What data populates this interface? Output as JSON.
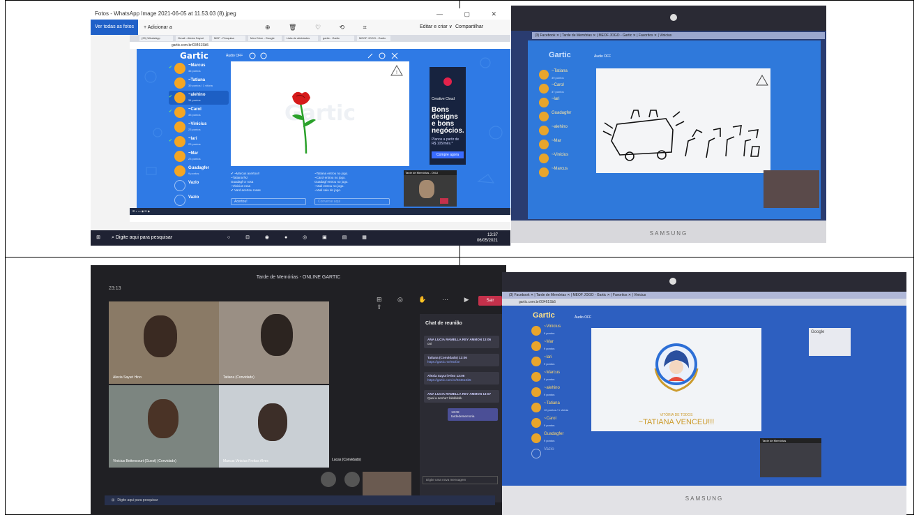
{
  "panel1": {
    "window_title": "Fotos - WhatsApp Image 2021-06-05 at 11.53.03 (8).jpeg",
    "window_controls": "— ▢ ✕",
    "all_photos": "Ver todas as fotos",
    "add_to": "+ Adicionar a",
    "viewer_tools": "⊕ 🗑 ♡ ⟲ ⌗",
    "edit_create": "Editar e criar ∨",
    "share": "Compartilhar",
    "browser_tabs": [
      "(29) WhatsApp",
      "Gmail - Alexia Sayuri",
      "MDF - Pesquisa",
      "Meu Drive - Google",
      "Lista de atividades",
      "gartic - Gartic",
      "MEOF JOGO - Gartic"
    ],
    "url": "gartic.com.br/03461Sb5",
    "gartic": {
      "logo": "Gartic",
      "audio": "Áudio OFF",
      "players": [
        {
          "name": "~Marcus",
          "score": "46 pontos",
          "checked": true,
          "highlight": false,
          "empty": false
        },
        {
          "name": "~Tatiana",
          "score": "39 pontos / 1 vitória",
          "checked": false,
          "highlight": false,
          "empty": false
        },
        {
          "name": "~alehino",
          "score": "34 pontos",
          "checked": true,
          "highlight": true,
          "empty": false
        },
        {
          "name": "~Carol",
          "score": "33 pontos",
          "checked": true,
          "highlight": false,
          "empty": false
        },
        {
          "name": "~Vinicius",
          "score": "23 pontos",
          "checked": false,
          "highlight": false,
          "empty": false
        },
        {
          "name": "~lari",
          "score": "23 pontos",
          "checked": true,
          "highlight": false,
          "empty": false
        },
        {
          "name": "~Mar",
          "score": "23 pontos",
          "checked": false,
          "highlight": false,
          "empty": false
        },
        {
          "name": "Guadagfer",
          "score": "9 pontos",
          "checked": false,
          "highlight": false,
          "empty": false
        },
        {
          "name": "Vazio",
          "score": "",
          "checked": false,
          "highlight": false,
          "empty": true
        },
        {
          "name": "Vazio",
          "score": "",
          "checked": false,
          "highlight": false,
          "empty": true
        }
      ],
      "chat_lines": [
        "✔ ~Marcus acertou!!",
        "~Tatiana fez",
        "Guadagf cr rosa",
        "~Vinicius rosa",
        "✔ Vard acertou rosas"
      ],
      "answer_lines": [
        "~Tatiana entrou no jogo.",
        "~Carol entrou no jogo.",
        "Guadagf entrou no jogo.",
        "~Vadi entrou no jogo.",
        "~Vadi saiu do jogo."
      ],
      "chat_input": "Acertou!",
      "answer_input": "Converse aqui",
      "ad": {
        "brand": "Creative Cloud",
        "headline": "Bons designs e bons negócios.",
        "sub": "Planos a partir de R$ 105/mês.*",
        "cta": "Compre agora"
      },
      "cam_title": "Tarde de Memórias - ONLI"
    },
    "taskbar": {
      "search": "Digite aqui para pesquisar",
      "time": "13:37",
      "date": "06/05/2021"
    }
  },
  "panel2": {
    "tabs": "(3) Facebook  ✕  |  Tarde de Memórias  ✕  |  MEOF JOGO - Gartic  ✕  |  Favoritos  ✕  |  Vinicius",
    "logo": "Gartic",
    "audio": "Áudio OFF",
    "players": [
      {
        "name": "~Tatiana",
        "score": "39 pontos"
      },
      {
        "name": "~Carol",
        "score": "37 pontos"
      },
      {
        "name": "~lari",
        "score": ""
      },
      {
        "name": "Guadagfer",
        "score": ""
      },
      {
        "name": "~alehino",
        "score": ""
      },
      {
        "name": "~Mar",
        "score": ""
      },
      {
        "name": "~Vinicius",
        "score": ""
      },
      {
        "name": "~Marcus",
        "score": ""
      }
    ],
    "brand": "SAMSUNG"
  },
  "panel3": {
    "title": "Tarde de Memórias - ONLINE GARTIC",
    "time": "23:13",
    "toolbar": "⊞ ◎ ✋ ⋯ ▶ 🎤 ⇧",
    "leave": "Sair",
    "tiles": [
      "Alexia Sayuri Hino",
      "Tatiana (Convidado)",
      "Vinicius Bettencourt (Guest) (Convidado)",
      "Marcus Vinicius Freitas Alves"
    ],
    "lucas": "Lucas (Convidado)",
    "chat": {
      "header": "Chat de reunião",
      "messages": [
        {
          "author": "ANA LUCIA RAMELLA REY AMMON  13:06",
          "text": "ooi",
          "link": ""
        },
        {
          "author": "Tatiana (Convidado)  13:06",
          "text": "",
          "link": "https://gartic.me/0Gf2e"
        },
        {
          "author": "Alexia Sayuri Hino  13:06",
          "text": "",
          "link": "https://gartic.com.br/03461Sb5"
        },
        {
          "author": "ANA LUCIA RAMELLA REY AMMON  13:07",
          "text": "Qual a senha?  kkkkkkkk",
          "link": ""
        }
      ],
      "mine": {
        "time": "13:08",
        "text": "tardedememoria"
      },
      "input": "Digite uma nova mensagem"
    },
    "taskbar": "Digite aqui para pesquisar"
  },
  "panel4": {
    "tabs": "(3) Facebook  ✕  |  Tarde de Memórias  ✕  |  MEOF JOGO - Gartic  ✕  |  Favoritos  ✕  |  Vinicius",
    "url": "gartic.com.br/03461Sb5",
    "logo": "Gartic",
    "audio": "Áudio OFF",
    "players": [
      {
        "name": "~Vinicius",
        "score": "9 pontos",
        "grey": false
      },
      {
        "name": "~Mar",
        "score": "9 pontos",
        "grey": false
      },
      {
        "name": "~lari",
        "score": "9 pontos",
        "grey": false
      },
      {
        "name": "~Marcus",
        "score": "9 pontos",
        "grey": false
      },
      {
        "name": "~alehino",
        "score": "9 pontos",
        "grey": false
      },
      {
        "name": "~Tatiana",
        "score": "10 pontos / 1 vitória",
        "grey": false
      },
      {
        "name": "~Carol",
        "score": "9 pontos",
        "grey": false
      },
      {
        "name": "Guadagfer",
        "score": "9 pontos",
        "grey": false
      },
      {
        "name": "Vazio",
        "score": "",
        "grey": true
      }
    ],
    "winner_sub": "VITÓRIA DE TODOS",
    "winner": "~TATIANA VENCEU!!!",
    "right_box": "Google",
    "cam_title": "Tarde de Memórias",
    "brand": "SAMSUNG"
  }
}
